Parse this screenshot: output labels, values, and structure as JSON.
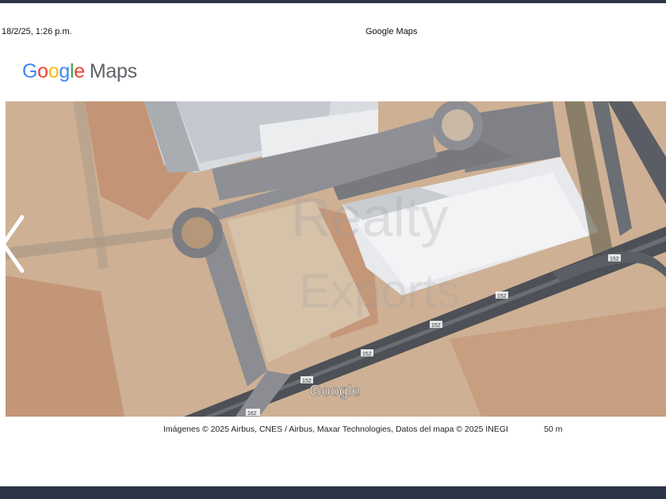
{
  "header": {
    "datetime": "18/2/25, 1:26 p.m.",
    "title": "Google Maps"
  },
  "logo": {
    "google": "Google",
    "maps": "Maps"
  },
  "map": {
    "watermark": "Google",
    "road_labels": [
      "152",
      "152",
      "152",
      "152",
      "152",
      "162"
    ],
    "attribution": "Imágenes © 2025 Airbus, CNES / Airbus, Maxar Technologies, Datos del mapa © 2025 INEGI",
    "scale": "50 m"
  },
  "nav": {
    "prev_icon": "chevron-left-icon"
  }
}
